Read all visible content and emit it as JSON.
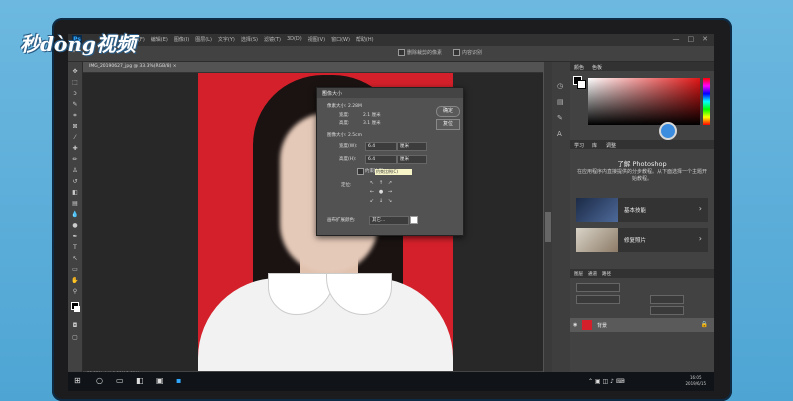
{
  "brand": {
    "logo_text": "秒dòng视频"
  },
  "app": {
    "ps_mark": "Ps",
    "menus": [
      "文件(F)",
      "编辑(E)",
      "图像(I)",
      "图层(L)",
      "文字(Y)",
      "选择(S)",
      "滤镜(T)",
      "3D(D)",
      "视图(V)",
      "窗口(W)",
      "帮助(H)"
    ],
    "window_controls": [
      "—",
      "□",
      "✕"
    ]
  },
  "options_bar": {
    "checkbox1": "删除裁剪的像素",
    "checkbox2": "内容识别"
  },
  "document": {
    "tab_label": "IMG_20190627_jpg @ 33.3%(RGB/8)  ×",
    "status": "33.33%   文档:1.21M/1.21M"
  },
  "dialog": {
    "title": "图像大小",
    "close": "✕",
    "ok_label": "确定",
    "reset_label": "复位",
    "pixel_size_label": "像素大小: 2.28M",
    "width_px_label": "宽度:",
    "width_px_value": "2.1 厘米",
    "height_px_label": "高度:",
    "height_px_value": "3.1 厘米",
    "doc_size_label": "图像大小: 2.5cm",
    "width_label": "宽度(W):",
    "width_value": "6.4",
    "width_unit": "厘米",
    "height_label": "高度(H):",
    "height_value": "6.4",
    "height_unit": "厘米",
    "constrain_label": "约束比例",
    "tooltip": "约束比例(C)",
    "anchor_label": "定位:",
    "canvas_ext_label": "画布扩展颜色:",
    "canvas_ext_value": "其它..."
  },
  "panels": {
    "color_tabs": [
      "颜色",
      "色板"
    ],
    "learn_tabs": [
      "学习",
      "库",
      "调整"
    ],
    "learn_title": "了解 Photoshop",
    "learn_desc": "在应用程序内直接提供的分步教程。从下面选择一个主题开始教程。",
    "cards": [
      {
        "label": "基本技能"
      },
      {
        "label": "修复照片"
      }
    ],
    "layers_tabs": [
      "图层",
      "通道",
      "路径"
    ],
    "layer_name": "背景"
  },
  "taskbar": {
    "clock_time": "16:05",
    "clock_date": "2019/6/15"
  },
  "colors": {
    "photo_bg": "#d4202a",
    "accent": "#31a8ff",
    "picker": "#3c8de0"
  }
}
